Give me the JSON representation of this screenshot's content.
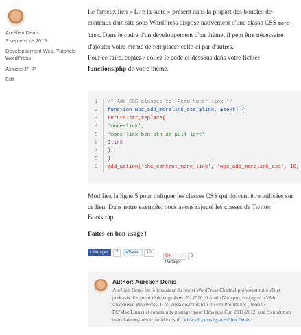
{
  "sidebar": {
    "author_name": "Aurélien Denis",
    "date": "3 septembre 2015",
    "categories": "Développement Web, Tutoriels WordPress",
    "tags": "Astuces PHP",
    "edit_label": "Edit"
  },
  "content": {
    "p1_before": "Le fameux lien « Lire la suite » présent dans la plupart des boucles de contenus d'un site sous WordPress dispose nativement d'une classe CSS ",
    "p1_code": "more-link",
    "p1_after": ". Dans le cadre d'un développement d'un thème, il peut être nécessaire d'ajouter voire même de remplacer celle-ci par d'autres.",
    "p2_before": "Pour ce faire, copiez / collez le code ci-dessous dans votre fichier ",
    "p2_bold": "functions.php",
    "p2_after": " de votre thème.",
    "code_lines": [
      {
        "n": "1",
        "text": "/* Add CSS classes to 'Read More' link */"
      },
      {
        "n": "2",
        "text": "function wpc_add_morelink_css($link, $text) {"
      },
      {
        "n": "3",
        "text": "return str_replace("
      },
      {
        "n": "4",
        "text": "'more-link',"
      },
      {
        "n": "5",
        "text": "'more-link btn btn-sm pull-left',"
      },
      {
        "n": "6",
        "text": "$link"
      },
      {
        "n": "7",
        "text": ");"
      },
      {
        "n": "8",
        "text": "}"
      },
      {
        "n": "9",
        "text": "add_action('the_content_more_link', 'wpc_add_morelink_css', 10, 2);"
      }
    ],
    "p3": "Modifiez la ligne 5 pour indiquer les classes CSS qui doivent être utilisées sur ce lien. Dans notre exemple, nous avons rajouté les classes de Twitter Bootstrap.",
    "p4": "Faites-en bon usage !"
  },
  "share": {
    "facebook_label": "Partager",
    "facebook_count": "7",
    "twitter_label": "Tweet",
    "twitter_count": "10",
    "gplus_label": "Partager",
    "gplus_count": "2"
  },
  "author_box": {
    "title": "Author: Aurélien Denis",
    "bio": "Aurélien Denis est le fondateur du projet WordPress Channel proposant tutoriels et podcasts librement téléchargeables. En 2010, il fonde Neticpro, une agence Web spécialisée WordPress. Il est aussi co-fondateur du site Protuts.net (tutoriels PC/Mac/Linux) et community manager pour l'Imagine Cup 2011/2012, une compétition mondiale organisée par Microsoft. ",
    "link_label": "View all posts by Aurélien Denis"
  },
  "colors": {
    "facebook": "#3b5998",
    "link": "#2a6ca8",
    "code_bg": "#f3f3f3"
  }
}
